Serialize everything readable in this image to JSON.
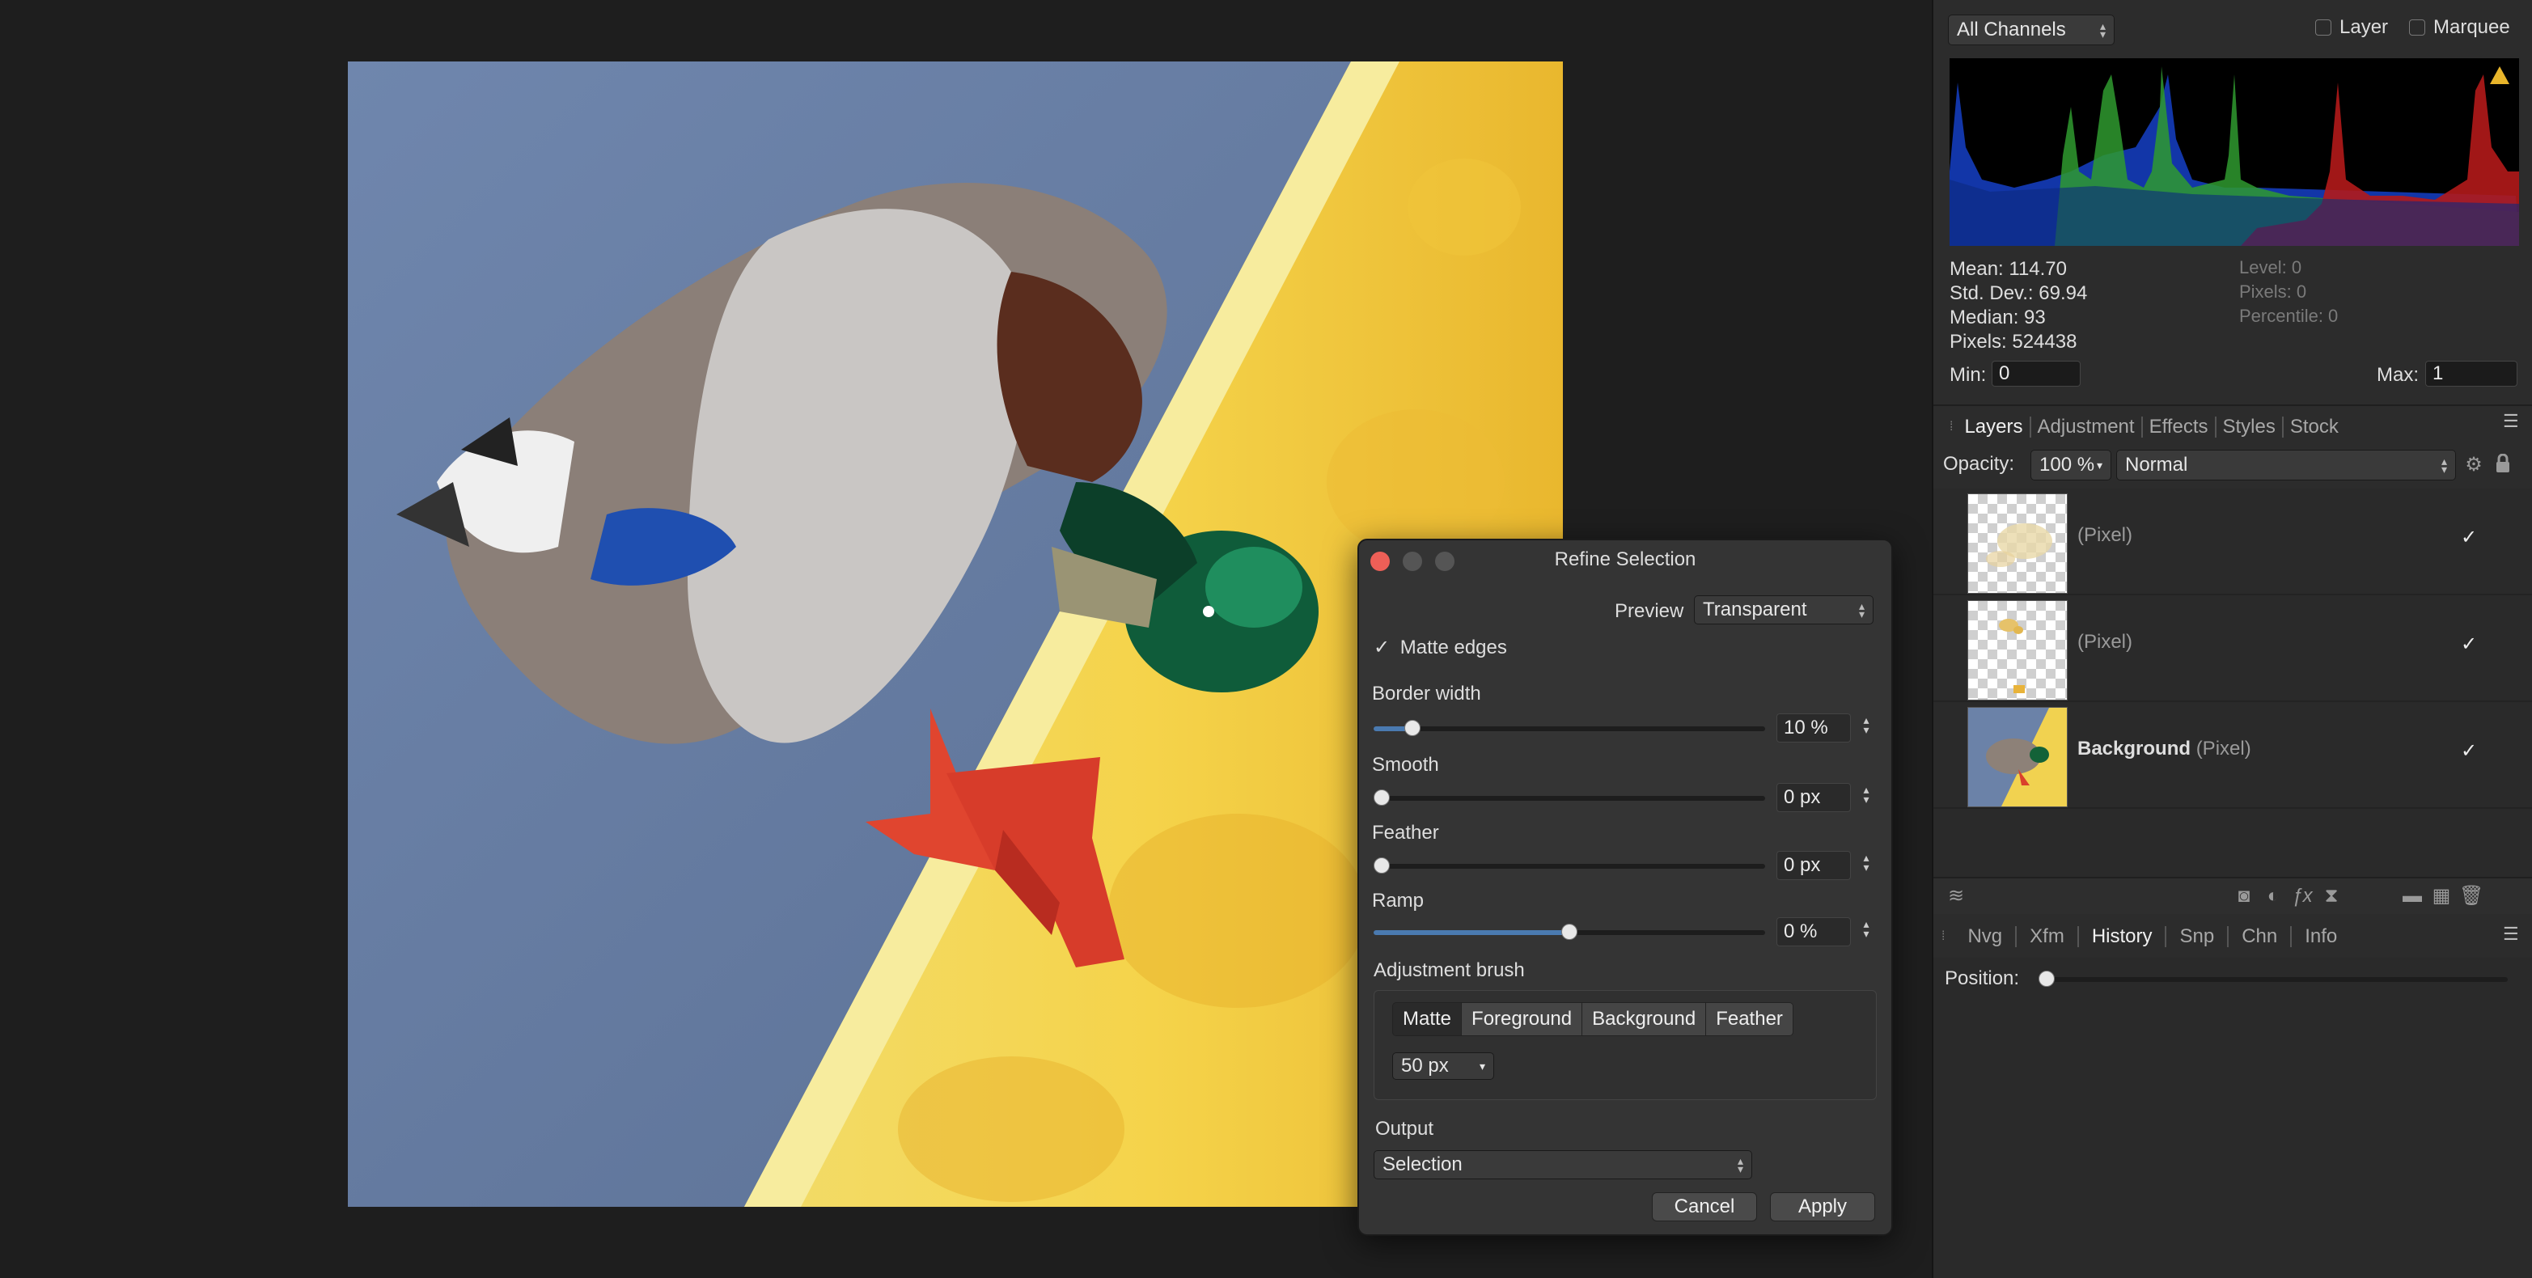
{
  "histogram": {
    "channel_select": "All Channels",
    "layer_label": "Layer",
    "marquee_label": "Marquee",
    "stats": [
      "Mean: 114.70",
      "Std. Dev.: 69.94",
      "Median: 93",
      "Pixels: 524438"
    ],
    "stats_right": [
      "Level: 0",
      "Pixels: 0",
      "Percentile: 0"
    ],
    "min_label": "Min:",
    "min_value": "0",
    "max_label": "Max:",
    "max_value": "1"
  },
  "layers_panel": {
    "tabs": [
      "Layers",
      "Adjustment",
      "Effects",
      "Styles",
      "Stock"
    ],
    "opacity_label": "Opacity:",
    "opacity_value": "100 %",
    "blend_mode": "Normal",
    "layers": [
      {
        "name": "",
        "type": "(Pixel)",
        "visible": "✓"
      },
      {
        "name": "",
        "type": "(Pixel)",
        "visible": "✓"
      },
      {
        "name": "Background",
        "type": "(Pixel)",
        "visible": "✓"
      }
    ]
  },
  "history_panel": {
    "tabs": [
      "Nvg",
      "Xfm",
      "History",
      "Snp",
      "Chn",
      "Info"
    ],
    "position_label": "Position:"
  },
  "dialog": {
    "title": "Refine Selection",
    "preview_label": "Preview",
    "preview_value": "Transparent",
    "matte_edges_label": "Matte edges",
    "matte_edges_check": "✓",
    "border_width_label": "Border width",
    "border_width_value": "10 %",
    "border_width_level": 0.1,
    "smooth_label": "Smooth",
    "smooth_value": "0 px",
    "feather_label": "Feather",
    "feather_value": "0 px",
    "ramp_label": "Ramp",
    "ramp_value": "0 %",
    "ramp_level": 0.5,
    "adjustment_brush_label": "Adjustment brush",
    "brush_modes": [
      "Matte",
      "Foreground",
      "Background",
      "Feather"
    ],
    "brush_size": "50 px",
    "output_label": "Output",
    "output_value": "Selection",
    "cancel_label": "Cancel",
    "apply_label": "Apply"
  }
}
